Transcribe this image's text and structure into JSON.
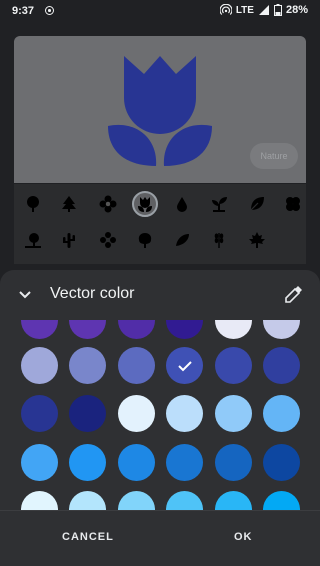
{
  "status_bar": {
    "time": "9:37",
    "network": "LTE",
    "battery": "28%"
  },
  "preview": {
    "chip_label": "Nature",
    "tulip_color": "#283593"
  },
  "icons": [
    [
      "tree-round-icon",
      "pine-tree-icon",
      "flower-icon",
      "tulip-icon",
      "leaf-drop-icon",
      "sprout-icon",
      "leaf-icon",
      "clover-icon"
    ],
    [
      "landscape-icon",
      "cactus-icon",
      "flower-outline-icon",
      "tree-icon",
      "feather-icon",
      "wheat-icon",
      "maple-leaf-icon"
    ]
  ],
  "sheet": {
    "title": "Vector color",
    "cancel_label": "CANCEL",
    "ok_label": "OK"
  },
  "swatches": [
    [
      "#5e35b1",
      "#5e35b1",
      "#512da8",
      "#311b92",
      "#e8eaf6",
      "#c5cae9"
    ],
    [
      "#9fa8da",
      "#7986cb",
      "#5c6bc0",
      "#3f51b5",
      "#3949ab",
      "#303f9f"
    ],
    [
      "#283593",
      "#1a237e",
      "#e3f2fd",
      "#bbdefb",
      "#90caf9",
      "#64b5f6"
    ],
    [
      "#42a5f5",
      "#2196f3",
      "#1e88e5",
      "#1976d2",
      "#1565c0",
      "#0d47a1"
    ],
    [
      "#e1f5fe",
      "#b3e5fc",
      "#81d4fa",
      "#4fc3f7",
      "#29b6f6",
      "#03a9f4"
    ]
  ],
  "selected_swatch": "#3f51b5"
}
